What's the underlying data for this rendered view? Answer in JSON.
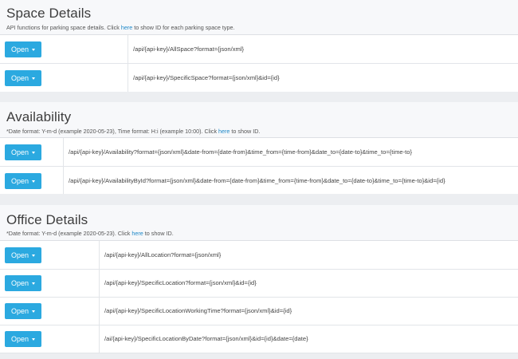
{
  "sections": [
    {
      "title": "Space Details",
      "desc_pre": "API functions for parking space details. Click ",
      "desc_link": "here",
      "desc_post": " to show ID for each parking space type.",
      "rows": [
        {
          "button": "Open",
          "endpoint": "/api/{api-key}/AllSpace?format={json/xml}"
        },
        {
          "button": "Open",
          "endpoint": "/api/{api-key}/SpecificSpace?format={json/xml}&id={id}"
        }
      ]
    },
    {
      "title": "Availability",
      "desc_pre": "*Date format: Y-m-d (example 2020-05-23), Time format: H:i (example 10:00). Click ",
      "desc_link": "here",
      "desc_post": " to show ID.",
      "rows": [
        {
          "button": "Open",
          "endpoint": "/api/{api-key}/Availability?format={json/xml}&date-from={date-from}&time_from={time-from}&date_to={date-to}&time_to={time-to}"
        },
        {
          "button": "Open",
          "endpoint": "/api/{api-key}/AvailabilityById?format={json/xml}&date-from={date-from}&time_from={time-from}&date_to={date-to}&time_to={time-to}&id={id}"
        }
      ]
    },
    {
      "title": "Office Details",
      "desc_pre": "*Date format: Y-m-d (example 2020-05-23). Click ",
      "desc_link": "here",
      "desc_post": " to show ID.",
      "rows": [
        {
          "button": "Open",
          "endpoint": "/api/{api-key}/AllLocation?format={json/xml}"
        },
        {
          "button": "Open",
          "endpoint": "/api/{api-key}/SpecificLocation?format={json/xml}&id={id}"
        },
        {
          "button": "Open",
          "endpoint": "/api/{api-key}/SpecificLocationWorkingTime?format={json/xml}&id={id}"
        },
        {
          "button": "Open",
          "endpoint": "/ai/{api-key}/SpecificLocationByDate?format={json/xml}&id={id}&date={date}"
        }
      ]
    }
  ],
  "colors": {
    "button": "#2ba9e0",
    "link": "#1e88c8",
    "page_background": "#eceef1",
    "section_background": "#f7f8fa"
  }
}
